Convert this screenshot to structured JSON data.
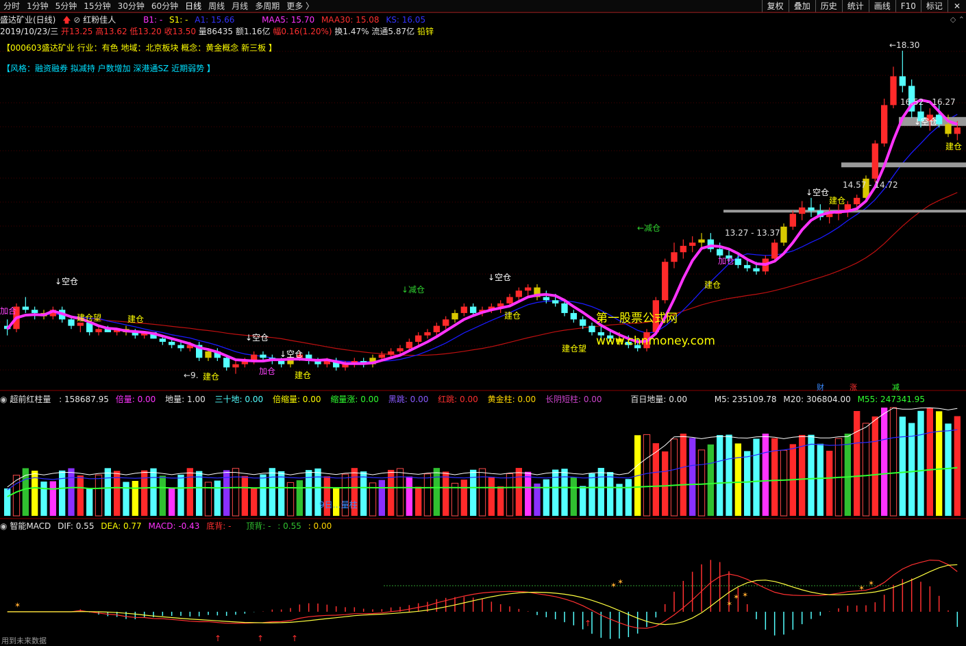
{
  "tabs": [
    "分时",
    "1分钟",
    "5分钟",
    "15分钟",
    "30分钟",
    "60分钟",
    "日线",
    "周线",
    "月线",
    "多周期",
    "更多 〉"
  ],
  "active_tab": "日线",
  "right_buttons": [
    "复权",
    "叠加",
    "历史",
    "统计",
    "画线",
    "F10",
    "标记"
  ],
  "stock": {
    "name_period": "盛达矿业(日线)",
    "indicator_name": "红粉佳人",
    "b1": "B1: -",
    "s1": "S1: -",
    "a1": "A1: 15.66",
    "maa5": "MAA5: 15.70",
    "maa30": "MAA30: 15.08",
    "ks": "KS: 16.05",
    "date": "2019/10/23/三",
    "open": "开13.25",
    "high": "高13.62",
    "low": "低13.20",
    "close": "收13.50",
    "volume": "量86435",
    "amount": "额1.16亿",
    "change": "幅0.16(1.20%)",
    "turnover": "换1.47%",
    "float_cap": "流通5.87亿",
    "sector_metal": "铅锌"
  },
  "tag1": "【000603盛达矿业 行业：有色 地域：北京板块 概念：黄金概念 新三板 】",
  "tag2": "【风格：融资融券 拟减持 户数增加 深港通SZ 近期弱势 】",
  "price_labels": [
    "18.30",
    "16.52 - 16.27",
    "14.57 - 14.72",
    "13.27 - 13.37",
    "9.",
    "建仓",
    "空仓",
    "加仓",
    "减仓",
    "建仓望",
    "加合"
  ],
  "watermark": {
    "cn": "第一股票公式网",
    "url": "www.chnmoney.com"
  },
  "event_badges": [
    "财",
    "涨",
    "减"
  ],
  "vol_indicator": {
    "title": "超前红柱量",
    "value": ": 158687.95",
    "beiliang": "倍量: 0.00",
    "diliang": "地量: 1.00",
    "sanshidi": "三十地: 0.00",
    "beisuoliang": "倍缩量: 0.00",
    "suoliangzhang": "缩量涨: 0.00",
    "heitiao": "黑跳: 0.00",
    "hongtiao": "红跳: 0.00",
    "huangjinzhu": "黄金柱: 0.00",
    "changyinduanzhu": "长阴短柱: 0.00",
    "bairidiliang": "百日地量: 0.00",
    "m5": "M5: 235109.78",
    "m20": "M20: 306804.00",
    "m55": "M55: 247341.95",
    "mark": "9日…量柱"
  },
  "macd": {
    "title": "智能MACD",
    "dif": "DIF: 0.55",
    "dea": "DEA: 0.77",
    "macd": "MACD: -0.43",
    "dibei": "底背: -",
    "dingbei": "顶背: -",
    "x1": ": 0.55",
    "x2": ": 0.00"
  },
  "footer_text": "用到未来数据",
  "colors": {
    "up": "#ff2a2a",
    "down": "#54ffff",
    "pink": "#ff33ff",
    "ma_blue": "#1a1aff",
    "ma_red": "#c01010",
    "yellow": "#d8c800"
  },
  "chart_data": {
    "type": "candlestick",
    "candles_ohlc": [
      [
        9.7,
        9.9,
        9.4,
        9.6
      ],
      [
        9.6,
        10.4,
        9.5,
        10.3
      ],
      [
        10.3,
        10.6,
        10.1,
        10.2
      ],
      [
        10.2,
        10.3,
        9.9,
        10.1
      ],
      [
        10.1,
        10.2,
        9.9,
        10.0
      ],
      [
        10.0,
        10.3,
        9.9,
        10.2
      ],
      [
        10.2,
        10.3,
        9.8,
        9.9
      ],
      [
        9.9,
        10.0,
        9.6,
        9.7
      ],
      [
        9.7,
        9.8,
        9.5,
        9.8
      ],
      [
        9.8,
        9.8,
        9.4,
        9.5
      ],
      [
        9.5,
        9.7,
        9.4,
        9.6
      ],
      [
        9.6,
        9.7,
        9.5,
        9.5
      ],
      [
        9.5,
        9.6,
        9.4,
        9.6
      ],
      [
        9.6,
        9.7,
        9.4,
        9.5
      ],
      [
        9.5,
        9.6,
        9.3,
        9.4
      ],
      [
        9.4,
        9.5,
        9.3,
        9.5
      ],
      [
        9.5,
        9.5,
        9.3,
        9.3
      ],
      [
        9.3,
        9.4,
        9.1,
        9.2
      ],
      [
        9.2,
        9.3,
        9.0,
        9.1
      ],
      [
        9.1,
        9.2,
        8.9,
        9.0
      ],
      [
        9.0,
        9.2,
        8.9,
        9.1
      ],
      [
        9.1,
        9.2,
        8.6,
        8.7
      ],
      [
        8.7,
        9.0,
        8.6,
        8.9
      ],
      [
        8.9,
        9.0,
        8.6,
        8.7
      ],
      [
        8.7,
        8.8,
        8.3,
        8.4
      ],
      [
        8.4,
        8.6,
        8.2,
        8.5
      ],
      [
        8.5,
        8.7,
        8.4,
        8.6
      ],
      [
        8.6,
        8.9,
        8.5,
        8.8
      ],
      [
        8.8,
        8.9,
        8.6,
        8.7
      ],
      [
        8.7,
        8.8,
        8.5,
        8.6
      ],
      [
        8.6,
        8.7,
        8.4,
        8.5
      ],
      [
        8.5,
        8.8,
        8.4,
        8.7
      ],
      [
        8.7,
        8.9,
        8.6,
        8.8
      ],
      [
        8.8,
        8.9,
        8.5,
        8.6
      ],
      [
        8.6,
        8.7,
        8.4,
        8.5
      ],
      [
        8.5,
        8.7,
        8.4,
        8.6
      ],
      [
        8.6,
        8.7,
        8.3,
        8.4
      ],
      [
        8.4,
        8.6,
        8.3,
        8.5
      ],
      [
        8.5,
        8.7,
        8.4,
        8.6
      ],
      [
        8.6,
        8.7,
        8.4,
        8.5
      ],
      [
        8.5,
        8.8,
        8.4,
        8.7
      ],
      [
        8.7,
        8.9,
        8.6,
        8.8
      ],
      [
        8.8,
        9.0,
        8.7,
        8.9
      ],
      [
        8.9,
        9.1,
        8.8,
        9.0
      ],
      [
        9.0,
        9.3,
        8.9,
        9.2
      ],
      [
        9.2,
        9.5,
        9.1,
        9.4
      ],
      [
        9.4,
        9.6,
        9.3,
        9.5
      ],
      [
        9.5,
        9.8,
        9.4,
        9.7
      ],
      [
        9.7,
        10.0,
        9.6,
        9.9
      ],
      [
        9.9,
        10.2,
        9.8,
        10.1
      ],
      [
        10.1,
        10.4,
        10.0,
        10.3
      ],
      [
        10.3,
        10.4,
        10.0,
        10.1
      ],
      [
        10.1,
        10.3,
        10.0,
        10.2
      ],
      [
        10.2,
        10.4,
        10.1,
        10.3
      ],
      [
        10.3,
        10.5,
        10.1,
        10.4
      ],
      [
        10.4,
        10.7,
        10.3,
        10.6
      ],
      [
        10.6,
        10.9,
        10.5,
        10.8
      ],
      [
        10.8,
        11.0,
        10.6,
        10.9
      ],
      [
        10.9,
        11.0,
        10.5,
        10.6
      ],
      [
        10.6,
        10.8,
        10.4,
        10.5
      ],
      [
        10.5,
        10.7,
        10.3,
        10.4
      ],
      [
        10.4,
        10.5,
        10.0,
        10.1
      ],
      [
        10.1,
        10.2,
        9.8,
        9.9
      ],
      [
        9.9,
        10.0,
        9.6,
        9.7
      ],
      [
        9.7,
        9.8,
        9.4,
        9.5
      ],
      [
        9.5,
        9.7,
        9.3,
        9.4
      ],
      [
        9.4,
        9.6,
        9.2,
        9.3
      ],
      [
        9.3,
        9.5,
        9.1,
        9.2
      ],
      [
        9.2,
        9.4,
        9.0,
        9.1
      ],
      [
        9.1,
        9.3,
        8.9,
        9.0
      ],
      [
        9.0,
        9.6,
        8.9,
        9.5
      ],
      [
        9.5,
        10.6,
        9.4,
        10.5
      ],
      [
        10.5,
        11.8,
        10.4,
        11.7
      ],
      [
        11.7,
        12.3,
        11.5,
        12.0
      ],
      [
        12.0,
        12.4,
        11.8,
        12.2
      ],
      [
        12.2,
        12.5,
        12.0,
        12.3
      ],
      [
        12.3,
        12.6,
        12.1,
        12.4
      ],
      [
        12.4,
        12.6,
        12.0,
        12.1
      ],
      [
        12.1,
        12.3,
        11.8,
        11.9
      ],
      [
        11.9,
        12.1,
        11.7,
        11.8
      ],
      [
        11.8,
        12.0,
        11.5,
        11.6
      ],
      [
        11.6,
        11.8,
        11.4,
        11.5
      ],
      [
        11.5,
        11.7,
        11.3,
        11.4
      ],
      [
        11.4,
        11.9,
        11.3,
        11.8
      ],
      [
        11.8,
        12.4,
        11.7,
        12.3
      ],
      [
        12.3,
        12.9,
        12.2,
        12.8
      ],
      [
        12.8,
        13.3,
        12.7,
        13.2
      ],
      [
        13.2,
        13.6,
        13.0,
        13.4
      ],
      [
        13.4,
        13.7,
        13.1,
        13.3
      ],
      [
        13.3,
        13.5,
        13.0,
        13.1
      ],
      [
        13.1,
        13.4,
        12.9,
        13.2
      ],
      [
        13.2,
        13.5,
        13.0,
        13.3
      ],
      [
        13.3,
        13.6,
        13.1,
        13.5
      ],
      [
        13.5,
        13.8,
        13.3,
        13.7
      ],
      [
        13.7,
        14.4,
        13.6,
        14.3
      ],
      [
        14.3,
        15.5,
        14.2,
        15.4
      ],
      [
        15.4,
        16.8,
        15.3,
        16.6
      ],
      [
        16.6,
        17.8,
        16.5,
        17.5
      ],
      [
        17.5,
        18.3,
        17.0,
        17.2
      ],
      [
        17.2,
        17.4,
        16.2,
        16.4
      ],
      [
        16.4,
        16.7,
        15.9,
        16.1
      ],
      [
        16.1,
        16.5,
        15.8,
        16.3
      ],
      [
        16.3,
        16.6,
        15.9,
        16.0
      ],
      [
        16.0,
        16.3,
        15.6,
        15.7
      ],
      [
        15.7,
        16.1,
        15.5,
        15.9
      ]
    ],
    "annotated_levels": {
      "high": 18.3,
      "zone1": [
        16.27,
        16.52
      ],
      "zone2": [
        14.57,
        14.72
      ],
      "zone3": [
        13.27,
        13.37
      ]
    }
  }
}
